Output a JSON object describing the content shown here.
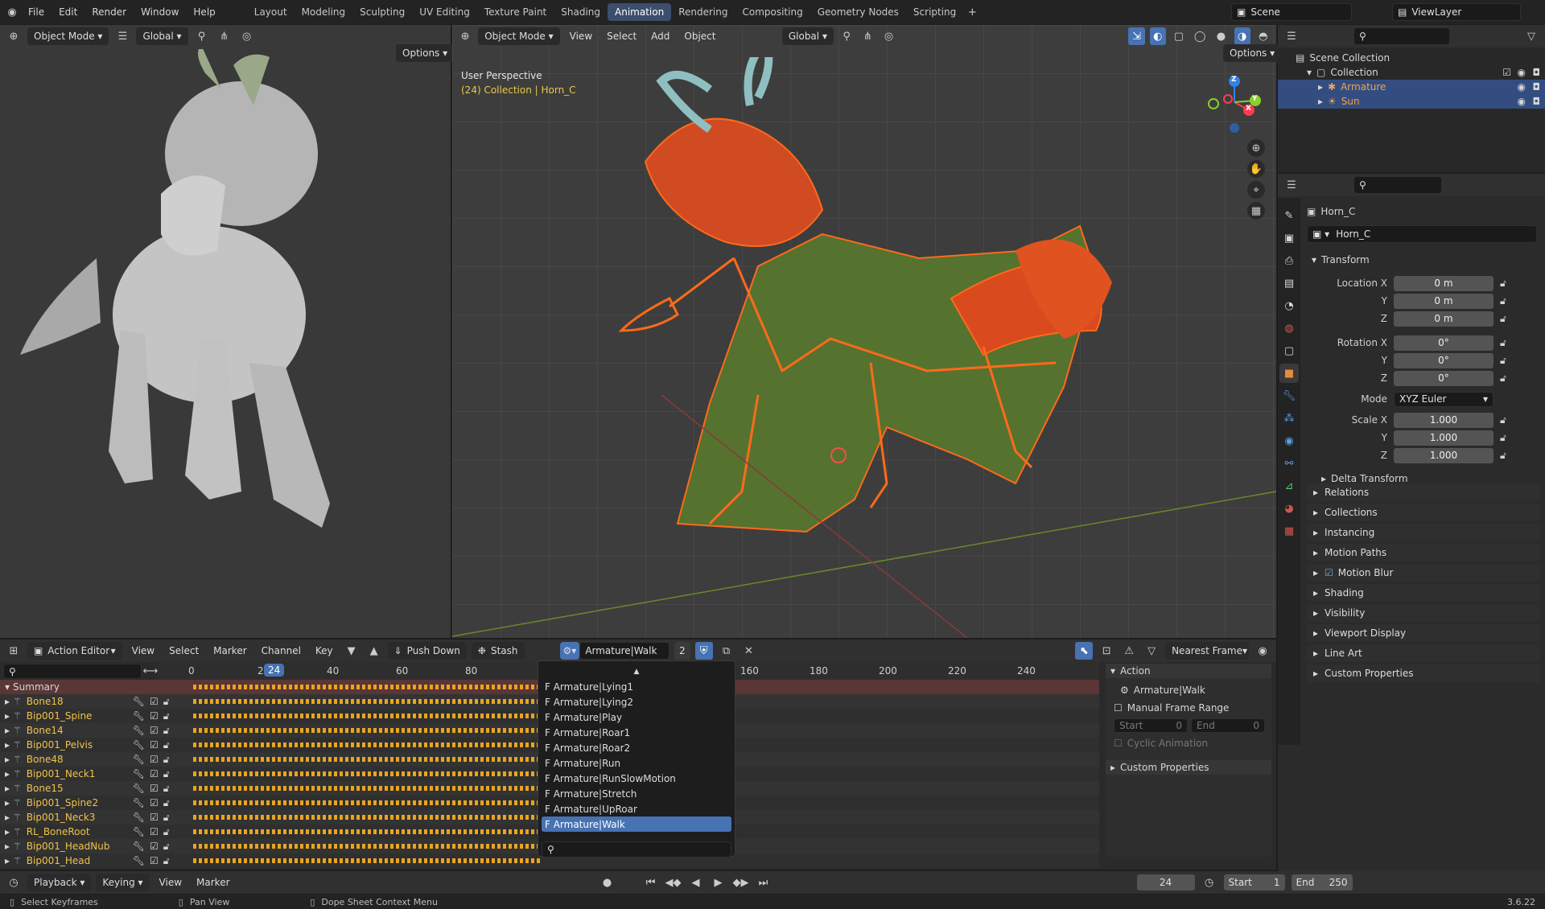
{
  "topbar": {
    "menus": [
      "File",
      "Edit",
      "Render",
      "Window",
      "Help"
    ],
    "workspaces": [
      "Layout",
      "Modeling",
      "Sculpting",
      "UV Editing",
      "Texture Paint",
      "Shading",
      "Animation",
      "Rendering",
      "Compositing",
      "Geometry Nodes",
      "Scripting"
    ],
    "active_workspace": "Animation",
    "scene": "Scene",
    "view_layer": "ViewLayer"
  },
  "left_view": {
    "mode": "Object Mode",
    "orientation": "Global",
    "options": "Options"
  },
  "main_view": {
    "mode": "Object Mode",
    "menus": [
      "View",
      "Select",
      "Add",
      "Object"
    ],
    "orientation": "Global",
    "options": "Options",
    "perspective": "User Perspective",
    "context": "(24) Collection | Horn_C",
    "gizmo": {
      "x": "X",
      "y": "Y",
      "z": "Z"
    }
  },
  "outliner": {
    "scene_collection": "Scene Collection",
    "collection": "Collection",
    "items": [
      "Armature",
      "Sun"
    ]
  },
  "properties": {
    "object_name": "Horn_C",
    "datablock": "Horn_C",
    "transform": "Transform",
    "location": {
      "label": "Location X",
      "x": "0 m",
      "y": "0 m",
      "z": "0 m"
    },
    "rotation": {
      "label": "Rotation X",
      "x": "0°",
      "y": "0°",
      "z": "0°"
    },
    "mode_label": "Mode",
    "mode": "XYZ Euler",
    "scale": {
      "label": "Scale X",
      "x": "1.000",
      "y": "1.000",
      "z": "1.000"
    },
    "y": "Y",
    "z": "Z",
    "delta": "Delta Transform",
    "panels": [
      "Relations",
      "Collections",
      "Instancing",
      "Motion Paths",
      "Motion Blur",
      "Shading",
      "Visibility",
      "Viewport Display",
      "Line Art",
      "Custom Properties"
    ]
  },
  "action_editor": {
    "mode": "Action Editor",
    "menus": [
      "View",
      "Select",
      "Marker",
      "Channel",
      "Key"
    ],
    "push_down": "Push Down",
    "stash": "Stash",
    "action": "Armature|Walk",
    "users": "2",
    "snap": "Nearest Frame",
    "summary": "Summary",
    "current_frame": "24",
    "ticks_left": [
      "0",
      "20",
      "40",
      "60",
      "80"
    ],
    "ticks_right": [
      "160",
      "180",
      "200",
      "220",
      "240"
    ],
    "channels": [
      "Bone18",
      "Bip001_Spine",
      "Bone14",
      "Bip001_Pelvis",
      "Bone48",
      "Bip001_Neck1",
      "Bone15",
      "Bip001_Spine2",
      "Bip001_Neck3",
      "RL_BoneRoot",
      "Bip001_HeadNub",
      "Bip001_Head"
    ]
  },
  "dropdown": {
    "items": [
      "F Armature|Lying1",
      "F Armature|Lying2",
      "F Armature|Play",
      "F Armature|Roar1",
      "F Armature|Roar2",
      "F Armature|Run",
      "F Armature|RunSlowMotion",
      "F Armature|Stretch",
      "F Armature|UpRoar",
      "F Armature|Walk"
    ],
    "selected_index": 9
  },
  "side_panel": {
    "title": "Action",
    "action": "Armature|Walk",
    "manual_range": "Manual Frame Range",
    "start_label": "Start",
    "start": "0",
    "end_label": "End",
    "end": "0",
    "cyclic": "Cyclic Animation",
    "custom": "Custom Properties"
  },
  "timeline": {
    "menus": [
      "Playback",
      "Keying",
      "View",
      "Marker"
    ],
    "frame": "24",
    "start_label": "Start",
    "start": "1",
    "end_label": "End",
    "end": "250"
  },
  "statusbar": {
    "left": "Select Keyframes",
    "mid": "Pan View",
    "right": "Dope Sheet Context Menu",
    "version": "3.6.22"
  }
}
